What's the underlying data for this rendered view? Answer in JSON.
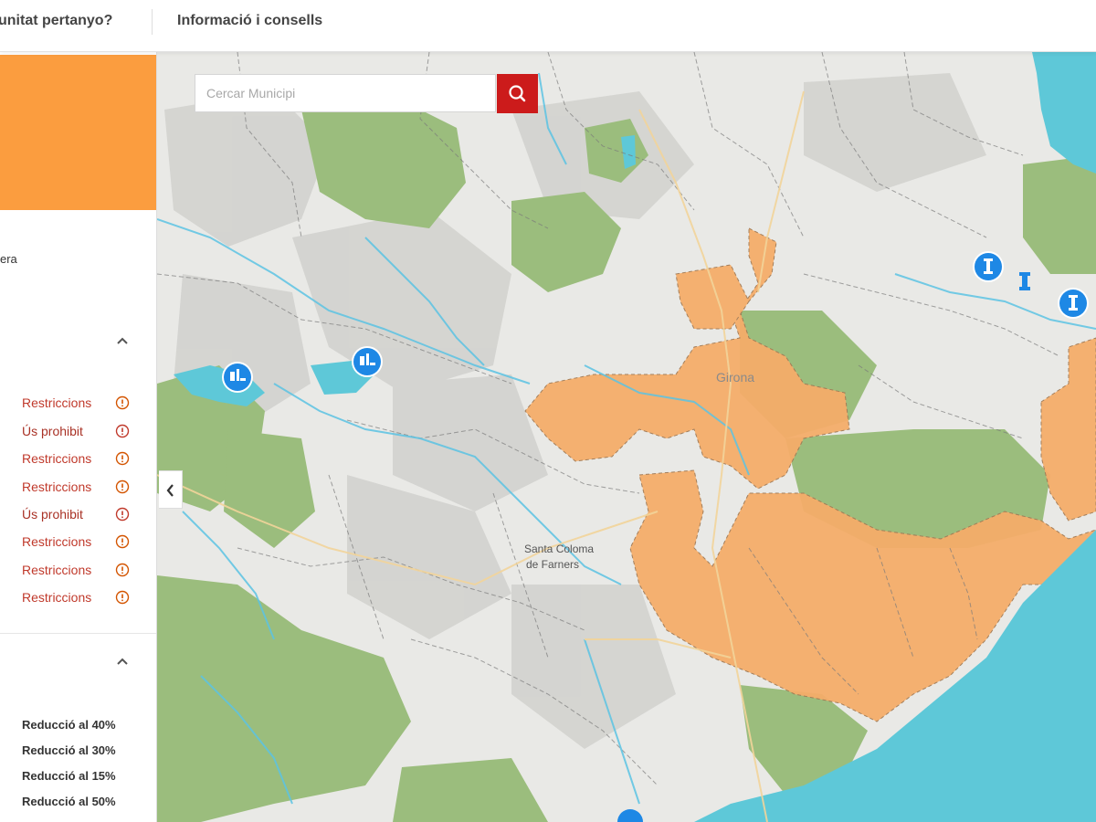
{
  "nav": {
    "link1": "unitat pertanyo?",
    "link2": "Informació i consells"
  },
  "sidebar": {
    "partial_text": "era",
    "status_items": [
      {
        "label": "Restriccions",
        "kind": "restriction"
      },
      {
        "label": "Ús prohibit",
        "kind": "prohibited"
      },
      {
        "label": "Restriccions",
        "kind": "restriction"
      },
      {
        "label": "Restriccions",
        "kind": "restriction"
      },
      {
        "label": "Ús prohibit",
        "kind": "prohibited"
      },
      {
        "label": "Restriccions",
        "kind": "restriction"
      },
      {
        "label": "Restriccions",
        "kind": "restriction"
      },
      {
        "label": "Restriccions",
        "kind": "restriction"
      }
    ],
    "reductions": [
      "Reducció al 40%",
      "Reducció al 30%",
      "Reducció al 15%",
      "Reducció al 50%"
    ]
  },
  "search": {
    "placeholder": "Cercar Municipi"
  },
  "map": {
    "place_labels": {
      "girona": "Girona",
      "santa_coloma_line1": "Santa Coloma",
      "santa_coloma_line2": "de Farners"
    },
    "markers": [
      {
        "type": "reservoir",
        "name": "reservoir-marker"
      },
      {
        "type": "reservoir",
        "name": "reservoir-marker"
      },
      {
        "type": "well",
        "name": "well-marker"
      },
      {
        "type": "well",
        "name": "well-marker"
      },
      {
        "type": "well",
        "name": "well-marker"
      }
    ]
  },
  "colors": {
    "accent_orange": "#fb9d3f",
    "search_button": "#cc1b1b",
    "restriction_text": "#c0392b",
    "sea": "#5ec8d8",
    "forest": "#8fb573",
    "affected_area": "#f6b06e",
    "marker_blue": "#1e88e5"
  }
}
